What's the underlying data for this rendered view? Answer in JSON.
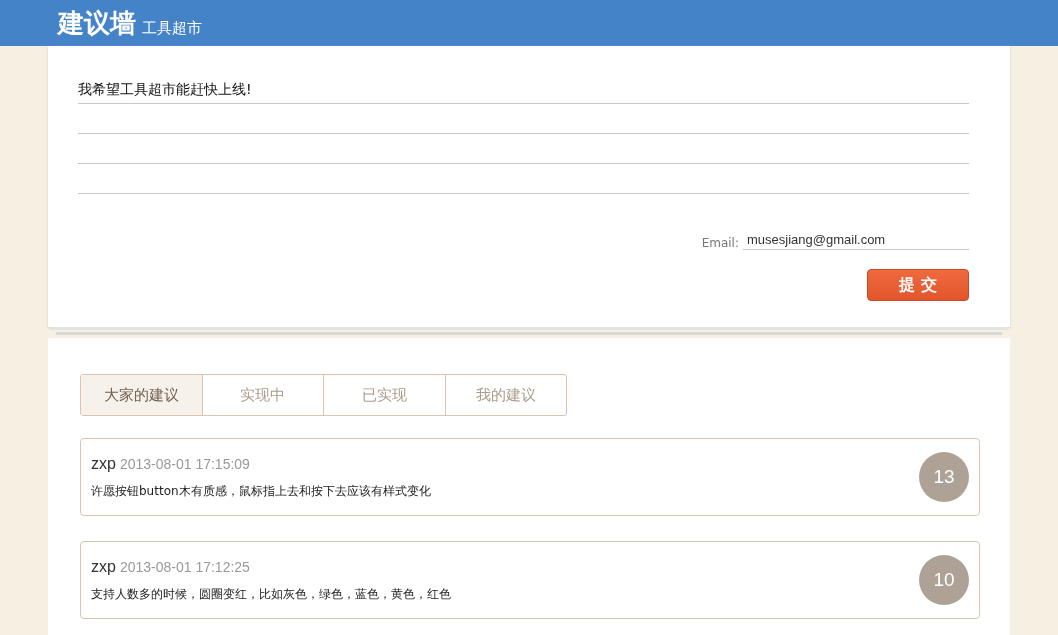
{
  "header": {
    "logo": "建议墙",
    "subtitle": "工具超市"
  },
  "form": {
    "suggestion": "我希望工具超市能赶快上线!",
    "email_label": "Email:",
    "email": "musesjiang@gmail.com",
    "submit": "提 交"
  },
  "tabs": [
    {
      "label": "大家的建议",
      "selected": true
    },
    {
      "label": "实现中",
      "selected": false
    },
    {
      "label": "已实现",
      "selected": false
    },
    {
      "label": "我的建议",
      "selected": false
    }
  ],
  "suggestions": [
    {
      "user": "zxp",
      "time": "2013-08-01 17:15:09",
      "text": "许愿按钮button木有质感，鼠标指上去和按下去应该有样式变化",
      "votes": "13"
    },
    {
      "user": "zxp",
      "time": "2013-08-01 17:12:25",
      "text": "支持人数多的时候，圆圈变红，比如灰色，绿色，蓝色，黄色，红色",
      "votes": "10"
    }
  ]
}
